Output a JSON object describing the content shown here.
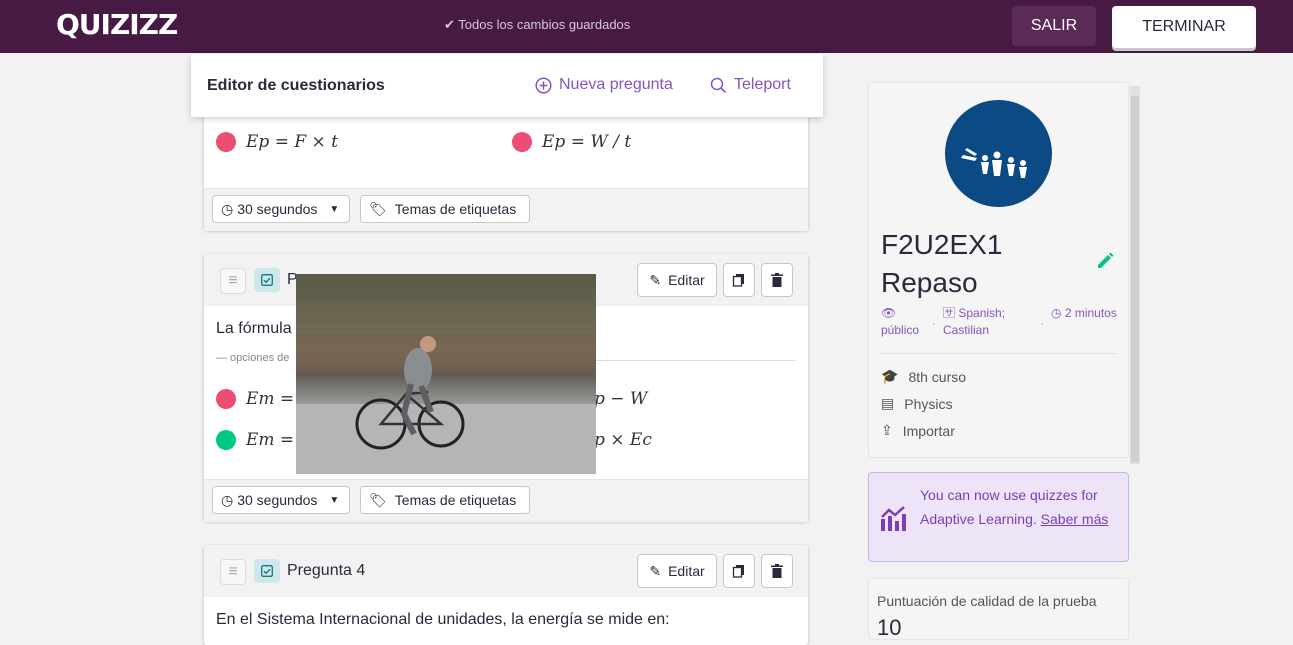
{
  "topbar": {
    "logo": "QUIZIZZ",
    "saved_status": "Todos los cambios guardados",
    "exit_label": "SALIR",
    "finish_label": "TERMINAR"
  },
  "editor_header": {
    "title": "Editor de cuestionarios",
    "new_question": "Nueva pregunta",
    "teleport": "Teleport"
  },
  "question_top": {
    "options": [
      {
        "color": "#ec4d73",
        "formula": "Ep = F × t"
      },
      {
        "color": "#ec4d73",
        "formula": "Ep = W / t"
      }
    ],
    "time_label": "30 segundos",
    "tags_label": "Temas de etiquetas"
  },
  "question_middle": {
    "label_partial": "P",
    "edit_label": "Editar",
    "text_partial": "La fórmula",
    "options_label": "— opciones de",
    "options": [
      {
        "color": "#ec4d73",
        "left": "Em = I",
        "right": "p − W"
      },
      {
        "color": "#00c985",
        "left": "Em = I",
        "right": "p × Ec"
      }
    ],
    "time_label": "30 segundos",
    "tags_label": "Temas de etiquetas"
  },
  "question_4": {
    "label": "Pregunta 4",
    "edit_label": "Editar",
    "text": "En el Sistema Internacional de unidades, la energía se mide en:"
  },
  "quiz_info": {
    "title": "F2U2EX1 Repaso",
    "visibility": "público",
    "language": "Spanish; Castilian",
    "duration": "2 minutos",
    "grade": "8th curso",
    "subject": "Physics",
    "import_label": "Importar"
  },
  "adaptive": {
    "text": "You can now use quizzes for Adaptive Learning.",
    "link": "Saber más"
  },
  "quality": {
    "label": "Puntuación de calidad de la prueba",
    "score": "10"
  }
}
